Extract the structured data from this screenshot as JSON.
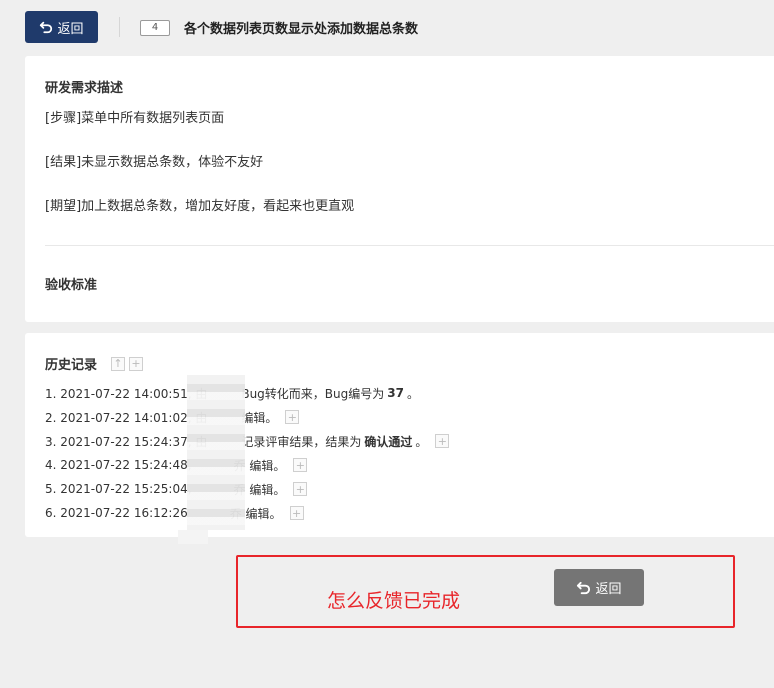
{
  "header": {
    "back_label": "返回",
    "story_id": "4",
    "title": "各个数据列表页数显示处添加数据总条数"
  },
  "requirement": {
    "heading": "研发需求描述",
    "lines": [
      "[步骤]菜单中所有数据列表页面",
      "[结果]未显示数据总条数，体验不友好",
      "[期望]加上数据总条数，增加友好度，看起来也更直观"
    ]
  },
  "acceptance": {
    "heading": "验收标准"
  },
  "history": {
    "heading": "历史记录",
    "entries": [
      {
        "pre": "1. 2021-07-22 14:00:51, 由",
        "post": "Bug转化而来，Bug编号为",
        "strong": "37",
        "tail": "。"
      },
      {
        "pre": "2. 2021-07-22 14:01:02, 由",
        "post": "编辑。",
        "strong": "",
        "tail": ""
      },
      {
        "pre": "3. 2021-07-22 15:24:37, 由",
        "post": "记录评审结果，结果为",
        "strong": "确认通过",
        "tail": "。"
      },
      {
        "pre": "4. 2021-07-22 15:24:48,",
        "post": "乔 编辑。",
        "strong": "",
        "tail": ""
      },
      {
        "pre": "5. 2021-07-22 15:25:04,",
        "post": "乔 编辑。",
        "strong": "",
        "tail": ""
      },
      {
        "pre": "6. 2021-07-22 16:12:26",
        "post": "乔 编辑。",
        "strong": "",
        "tail": ""
      }
    ]
  },
  "annotation": {
    "text": "怎么反馈已完成",
    "back_label": "返回"
  },
  "icons": {
    "back": "undo-arrow-icon",
    "sort_up": "arrow-up-icon",
    "expand": "plus-icon"
  },
  "colors": {
    "primary": "#1f3a6b",
    "annotation_red": "#e8252a",
    "grey_button": "#757575"
  }
}
